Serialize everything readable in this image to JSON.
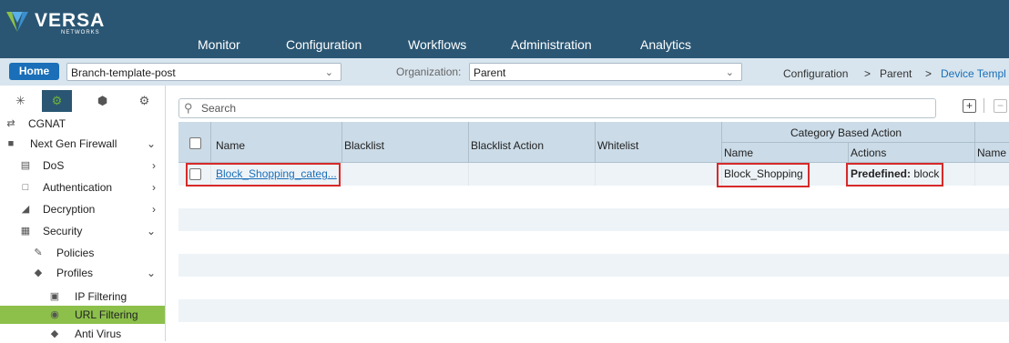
{
  "brand": {
    "name": "VERSA",
    "sub": "NETWORKS"
  },
  "nav": {
    "monitor": "Monitor",
    "configuration": "Configuration",
    "workflows": "Workflows",
    "administration": "Administration",
    "analytics": "Analytics"
  },
  "subbar": {
    "home": "Home",
    "template": "Branch-template-post",
    "org_label": "Organization:",
    "org_value": "Parent",
    "breadcrumb": [
      "Configuration",
      ">",
      "Parent",
      ">",
      "Device Templ"
    ]
  },
  "sidebar": {
    "items": [
      {
        "label": "CGNAT"
      },
      {
        "label": "Next Gen Firewall"
      },
      {
        "label": "DoS"
      },
      {
        "label": "Authentication"
      },
      {
        "label": "Decryption"
      },
      {
        "label": "Security"
      },
      {
        "label": "Policies"
      },
      {
        "label": "Profiles"
      },
      {
        "label": "IP Filtering"
      },
      {
        "label": "URL Filtering"
      },
      {
        "label": "Anti Virus"
      }
    ]
  },
  "search": {
    "placeholder": "Search"
  },
  "table": {
    "headers": {
      "name": "Name",
      "blacklist": "Blacklist",
      "blacklist_action": "Blacklist Action",
      "whitelist": "Whitelist",
      "group": "Category Based Action",
      "cba_name": "Name",
      "cba_actions": "Actions",
      "next_name": "Name"
    },
    "rows": [
      {
        "name": "Block_Shopping_categ...",
        "blacklist": "",
        "blacklist_action": "",
        "whitelist": "",
        "cba_name": "Block_Shopping",
        "cba_action_bold": "Predefined:",
        "cba_action_value": "block"
      }
    ]
  },
  "colors": {
    "topbar": "#2a5673",
    "accent_green": "#8cc04b",
    "link": "#1a6fb8",
    "highlight": "#d62a2a"
  }
}
